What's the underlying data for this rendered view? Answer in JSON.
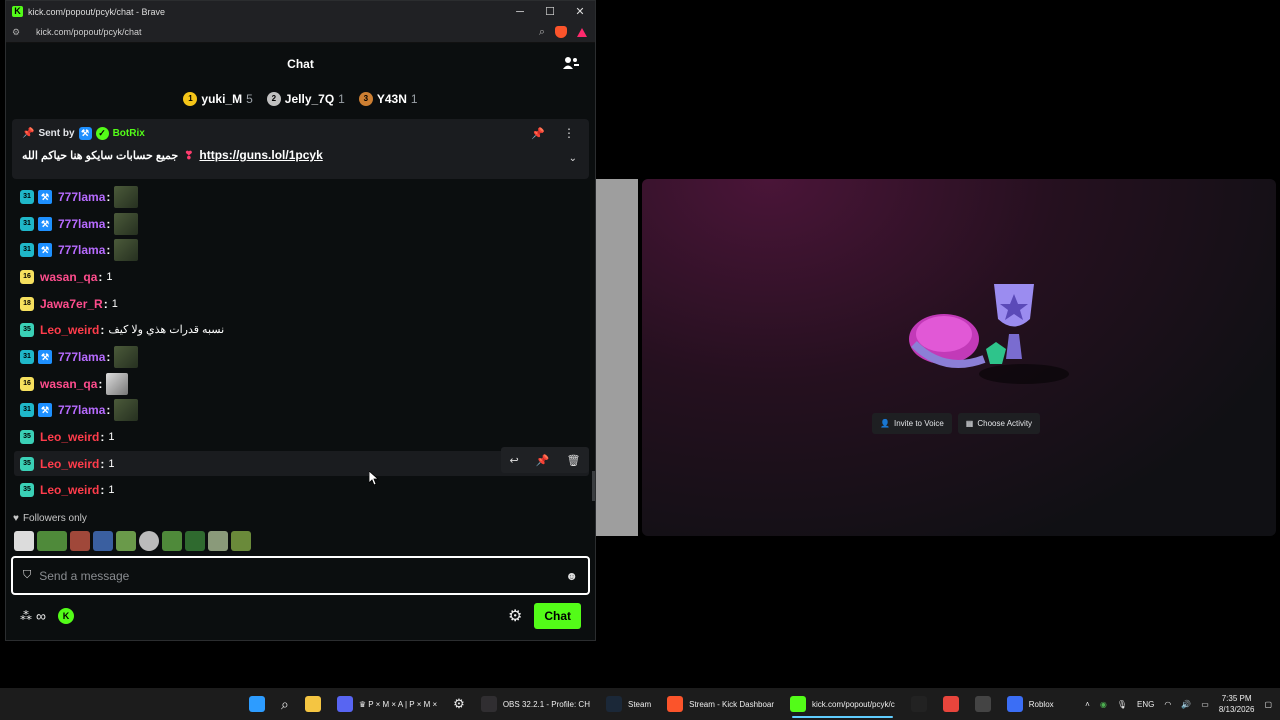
{
  "browser": {
    "title": "kick.com/popout/pcyk/chat - Brave",
    "url": "kick.com/popout/pcyk/chat",
    "controls": {
      "minimize": "─",
      "maximize": "☐",
      "close": "✕"
    }
  },
  "chat": {
    "header_title": "Chat",
    "leaderboard": [
      {
        "rank": "1",
        "name": "yuki_M",
        "count": "5",
        "color": "#f5c518"
      },
      {
        "rank": "2",
        "name": "Jelly_7Q",
        "count": "1",
        "color": "#c0c0c0"
      },
      {
        "rank": "3",
        "name": "Y43N",
        "count": "1",
        "color": "#cd7f32"
      }
    ],
    "pinned": {
      "sent_by_label": "Sent by",
      "bot_name": "BotRix",
      "message": "جميع حسابات سايكو هنا حياكم الله",
      "link": "https://guns.lol/1pcyk"
    },
    "messages": [
      {
        "badge": "31",
        "badge_color": "#1fb7c9",
        "mod": true,
        "user": "777lama",
        "user_color": "#b76bff",
        "text": "",
        "emote": "dark"
      },
      {
        "badge": "31",
        "badge_color": "#1fb7c9",
        "mod": true,
        "user": "777lama",
        "user_color": "#b76bff",
        "text": "",
        "emote": "dark"
      },
      {
        "badge": "31",
        "badge_color": "#1fb7c9",
        "mod": true,
        "user": "777lama",
        "user_color": "#b76bff",
        "text": "",
        "emote": "dark"
      },
      {
        "badge": "16",
        "badge_color": "#f6e05e",
        "mod": false,
        "user": "wasan_qa",
        "user_color": "#ff4d8d",
        "text": "1",
        "emote": ""
      },
      {
        "badge": "18",
        "badge_color": "#f6e05e",
        "mod": false,
        "user": "Jawa7er_R",
        "user_color": "#ff4d8d",
        "text": "1",
        "emote": ""
      },
      {
        "badge": "35",
        "badge_color": "#3ad0b6",
        "mod": false,
        "user": "Leo_weird",
        "user_color": "#ff3c4b",
        "text": "نسبه قدرات هذي ولا كيف",
        "emote": ""
      },
      {
        "badge": "31",
        "badge_color": "#1fb7c9",
        "mod": true,
        "user": "777lama",
        "user_color": "#b76bff",
        "text": "",
        "emote": "dark"
      },
      {
        "badge": "16",
        "badge_color": "#f6e05e",
        "mod": false,
        "user": "wasan_qa",
        "user_color": "#ff4d8d",
        "text": "",
        "emote": "white"
      },
      {
        "badge": "31",
        "badge_color": "#1fb7c9",
        "mod": true,
        "user": "777lama",
        "user_color": "#b76bff",
        "text": "",
        "emote": "dark"
      },
      {
        "badge": "35",
        "badge_color": "#3ad0b6",
        "mod": false,
        "user": "Leo_weird",
        "user_color": "#ff3c4b",
        "text": "1",
        "emote": ""
      },
      {
        "badge": "35",
        "badge_color": "#3ad0b6",
        "mod": false,
        "user": "Leo_weird",
        "user_color": "#ff3c4b",
        "text": "1",
        "emote": ""
      },
      {
        "badge": "35",
        "badge_color": "#3ad0b6",
        "mod": false,
        "user": "Leo_weird",
        "user_color": "#ff3c4b",
        "text": "1",
        "emote": ""
      }
    ],
    "followers_only": "Followers only",
    "input_placeholder": "Send a message",
    "send_button": "Chat"
  },
  "stage": {
    "invite_button": "Invite to Voice",
    "activity_button": "Choose Activity"
  },
  "taskbar": {
    "apps": [
      {
        "icon": "discord-icon",
        "label": "♛ P × M × A | P × M ×",
        "color": "#5865f2"
      },
      {
        "icon": "obs-icon",
        "label": "OBS 32.2.1 - Profile: CH",
        "color": "#302e31"
      },
      {
        "icon": "steam-icon",
        "label": "Steam",
        "color": "#1b2838"
      },
      {
        "icon": "brave-icon",
        "label": "Stream - Kick Dashboar",
        "color": "#fb542b"
      },
      {
        "icon": "kick-icon",
        "label": "kick.com/popout/pcyk/c",
        "color": "#53fc18"
      },
      {
        "icon": "roblox-icon",
        "label": "Roblox",
        "color": "#3b6ef5"
      }
    ],
    "language": "ENG",
    "time": "7:35 PM",
    "date": "8/13/2026"
  }
}
